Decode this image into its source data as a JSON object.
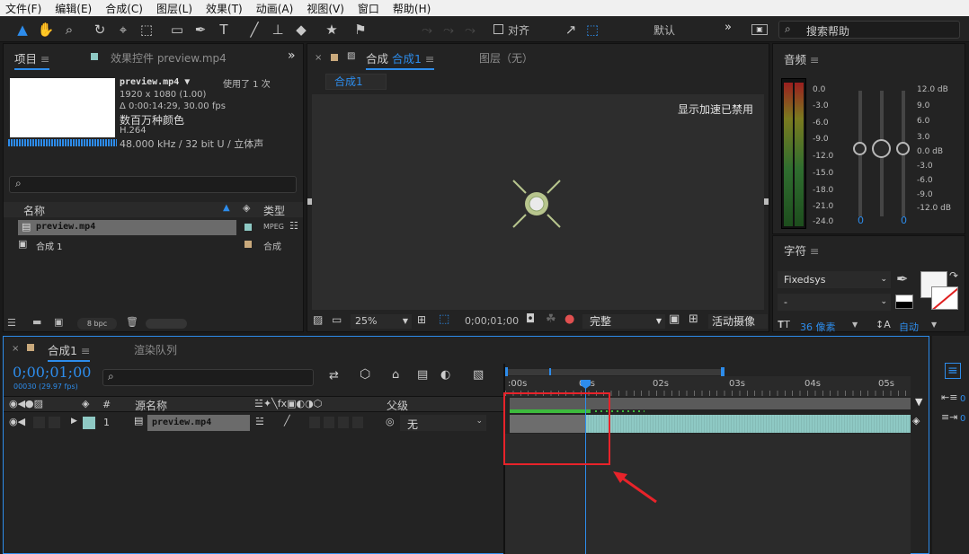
{
  "menu": [
    "文件(F)",
    "编辑(E)",
    "合成(C)",
    "图层(L)",
    "效果(T)",
    "动画(A)",
    "视图(V)",
    "窗口",
    "帮助(H)"
  ],
  "toolbar": {
    "align_label": "对齐",
    "workspace": "默认",
    "search_placeholder": "搜索帮助"
  },
  "project": {
    "tab_project": "项目",
    "tab_effects": "效果控件 preview.mp4",
    "file_name": "preview.mp4",
    "usage": "使用了 1 次",
    "resolution": "1920 x 1080 (1.00)",
    "duration": "Δ 0:00:14:29, 30.00 fps",
    "colors": "数百万种颜色",
    "codec": "H.264",
    "audio": "48.000 kHz / 32 bit U / 立体声",
    "col_name": "名称",
    "col_type": "类型",
    "items": [
      {
        "name": "preview.mp4",
        "type": "MPEG",
        "color": "#8ec9c4",
        "selected": true
      },
      {
        "name": "合成 1",
        "type": "合成",
        "color": "#c9a97c",
        "selected": false
      }
    ],
    "bpc": "8 bpc"
  },
  "composition": {
    "tab_label": "合成",
    "tab_name": "合成1",
    "layer_tab": "图层（无）",
    "sub_tab": "合成1",
    "notice": "显示加速已禁用",
    "zoom": "25%",
    "timecode": "0;00;01;00",
    "quality": "完整",
    "camera": "活动摄像"
  },
  "audio": {
    "title": "音频",
    "left_scale": [
      "0.0",
      "-3.0",
      "-6.0",
      "-9.0",
      "-12.0",
      "-15.0",
      "-18.0",
      "-21.0",
      "-24.0"
    ],
    "right_scale": [
      "12.0 dB",
      "9.0",
      "6.0",
      "3.0",
      "0.0 dB",
      "-3.0",
      "-6.0",
      "-9.0",
      "-12.0 dB"
    ],
    "left_val": "0",
    "right_val": "0"
  },
  "character": {
    "title": "字符",
    "font": "Fixedsys",
    "style": "-",
    "size": "36 像素",
    "leading": "自动"
  },
  "timeline": {
    "tab_comp": "合成1",
    "tab_render": "渲染队列",
    "timecode": "0;00;01;00",
    "frame_info": "00030 (29.97 fps)",
    "col_source": "源名称",
    "col_parent": "父级",
    "col_num": "#",
    "layer_num": "1",
    "layer_name": "preview.mp4",
    "parent_value": "无",
    "ruler": [
      ":00s",
      "01s",
      "02s",
      "03s",
      "04s",
      "05s"
    ]
  },
  "colors": {
    "accent_blue": "#2d8ceb",
    "annotation_red": "#e8232a",
    "layer_teal": "#8ec9c4",
    "comp_tan": "#c9a97c"
  }
}
